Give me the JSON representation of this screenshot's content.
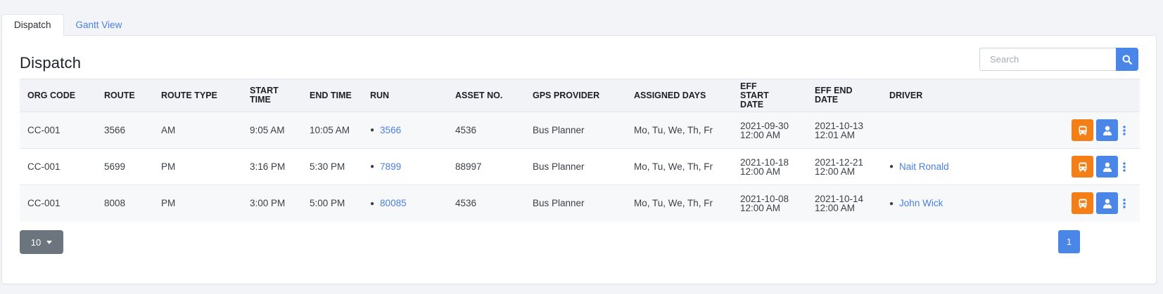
{
  "tabs": [
    {
      "label": "Dispatch",
      "active": true
    },
    {
      "label": "Gantt View",
      "active": false
    }
  ],
  "page_title": "Dispatch",
  "search": {
    "placeholder": "Search",
    "value": "",
    "icon": "search-icon"
  },
  "columns": [
    "ORG CODE",
    "ROUTE",
    "ROUTE TYPE",
    "START TIME",
    "END TIME",
    "RUN",
    "ASSET NO.",
    "GPS PROVIDER",
    "ASSIGNED DAYS",
    "EFF START DATE",
    "EFF END DATE",
    "DRIVER"
  ],
  "rows": [
    {
      "org_code": "CC-001",
      "route": "3566",
      "route_type": "AM",
      "start_time": "9:05 AM",
      "end_time": "10:05 AM",
      "run": "3566",
      "asset_no": "4536",
      "gps_provider": "Bus Planner",
      "assigned_days": "Mo, Tu, We, Th, Fr",
      "eff_start_date": "2021-09-30",
      "eff_start_time": "12:00 AM",
      "eff_end_date": "2021-10-13",
      "eff_end_time": "12:01 AM",
      "driver": ""
    },
    {
      "org_code": "CC-001",
      "route": "5699",
      "route_type": "PM",
      "start_time": "3:16 PM",
      "end_time": "5:30 PM",
      "run": "7899",
      "asset_no": "88997",
      "gps_provider": "Bus Planner",
      "assigned_days": "Mo, Tu, We, Th, Fr",
      "eff_start_date": "2021-10-18",
      "eff_start_time": "12:00 AM",
      "eff_end_date": "2021-12-21",
      "eff_end_time": "12:00 AM",
      "driver": "Nait Ronald"
    },
    {
      "org_code": "CC-001",
      "route": "8008",
      "route_type": "PM",
      "start_time": "3:00 PM",
      "end_time": "5:00 PM",
      "run": "80085",
      "asset_no": "4536",
      "gps_provider": "Bus Planner",
      "assigned_days": "Mo, Tu, We, Th, Fr",
      "eff_start_date": "2021-10-08",
      "eff_start_time": "12:00 AM",
      "eff_end_date": "2021-10-14",
      "eff_end_time": "12:00 AM",
      "driver": "John Wick"
    }
  ],
  "row_actions": {
    "bus_icon": "bus-icon",
    "driver_icon": "driver-icon",
    "more_icon": "kebab-menu-icon"
  },
  "pagination": {
    "page_size": "10",
    "current_page": "1"
  },
  "colors": {
    "primary": "#4a86e8",
    "accent_orange": "#f57f17",
    "link": "#4a7fe0",
    "secondary": "#6c757d"
  }
}
